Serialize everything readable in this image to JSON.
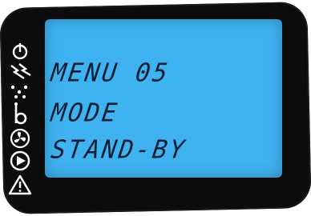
{
  "display": {
    "line1": "MENU 05",
    "line2": "MODE",
    "line3": "STAND-BY"
  },
  "colors": {
    "bezel": "#0c0c0c",
    "screen": "#3fb2f0",
    "segment_text": "#0a1f35",
    "icon": "#ffffff"
  },
  "side_icons": [
    "power-icon",
    "lightning-icon",
    "sparkle-icon",
    "probe-icon",
    "fan-icon",
    "play-icon",
    "warning-icon"
  ]
}
